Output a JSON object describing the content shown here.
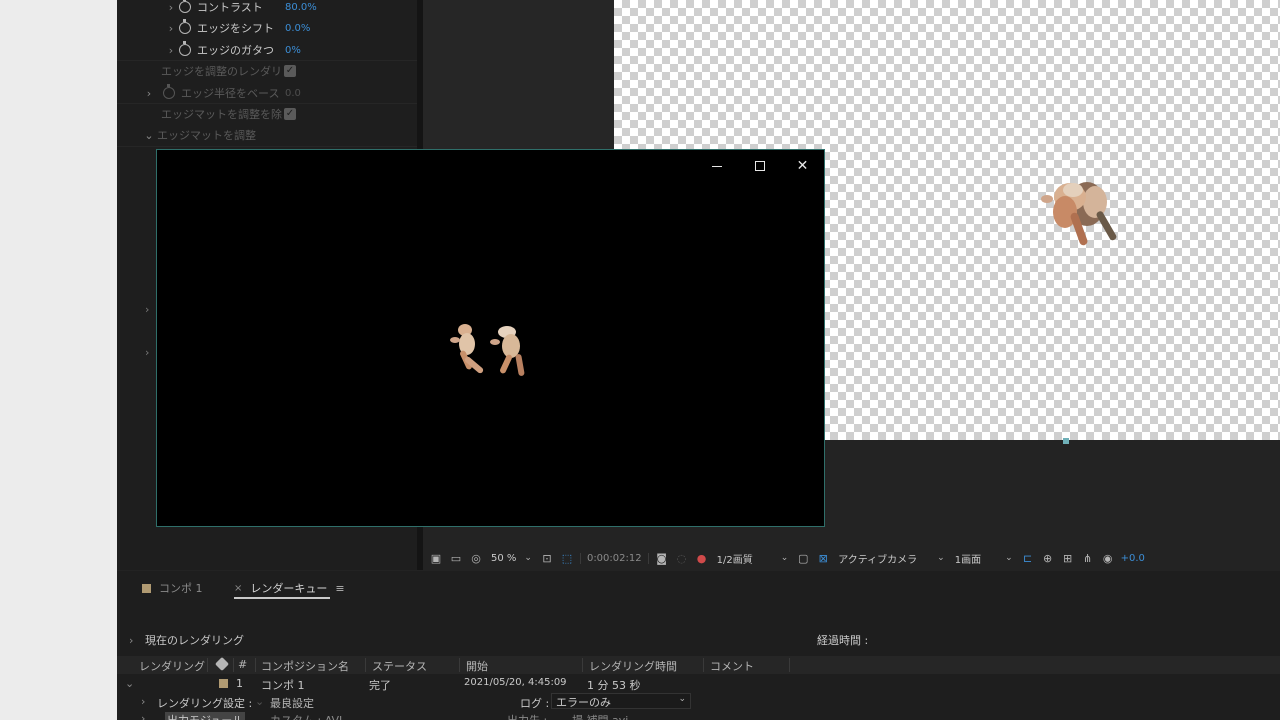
{
  "effect_controls": {
    "properties": [
      {
        "name": "コントラスト",
        "value": "80.0",
        "unit": "%"
      },
      {
        "name": "エッジをシフト",
        "value": "0.0",
        "unit": "%"
      },
      {
        "name": "エッジのガタつ",
        "value": "0",
        "unit": "%"
      },
      {
        "name": "エッジを調整のレンダリ"
      },
      {
        "name": "エッジ半径をベース",
        "value": "0.0"
      },
      {
        "name": "エッジマットを調整を除"
      },
      {
        "name": "エッジマットを調整"
      }
    ],
    "checkbox_mark": "✓"
  },
  "player_window": {
    "minimize_label": "—",
    "maximize_label": "□",
    "close_label": "✕"
  },
  "viewer_toolbar": {
    "zoom": "50 %",
    "timecode": "0:00:02:12",
    "resolution": "1/2画質",
    "camera": "アクティブカメラ",
    "views": "1画面",
    "exposure": "+0.0"
  },
  "panel_tabs": {
    "comp_tab": "コンポ 1",
    "render_queue_tab": "レンダーキュー",
    "close_glyph": "×",
    "menu_glyph": "≡"
  },
  "render_status": {
    "current_render_label": "現在のレンダリング",
    "elapsed_label": "経過時間 :"
  },
  "queue_columns": {
    "render": "レンダリング",
    "number": "#",
    "comp_name": "コンポジション名",
    "status": "ステータス",
    "started": "開始",
    "render_time": "レンダリング時間",
    "comment": "コメント"
  },
  "queue_items": [
    {
      "number": "1",
      "comp_name": "コンポ 1",
      "status": "完了",
      "started": "2021/05/20, 4:45:09",
      "render_time": "1 分 53 秒"
    }
  ],
  "render_settings": {
    "label": "レンダリング設定 :",
    "value": "最良設定",
    "log_label": "ログ :",
    "log_value": "エラーのみ"
  },
  "output_module": {
    "label": "出力モジュール",
    "value": "カスタム : AVI",
    "output_to_label": "出力先 :",
    "output_to_value": "場 補間.avi"
  },
  "colors": {
    "accent_blue": "#3c8ed6",
    "comp_label": "#b09a72",
    "window_border": "#2f6f6a"
  }
}
